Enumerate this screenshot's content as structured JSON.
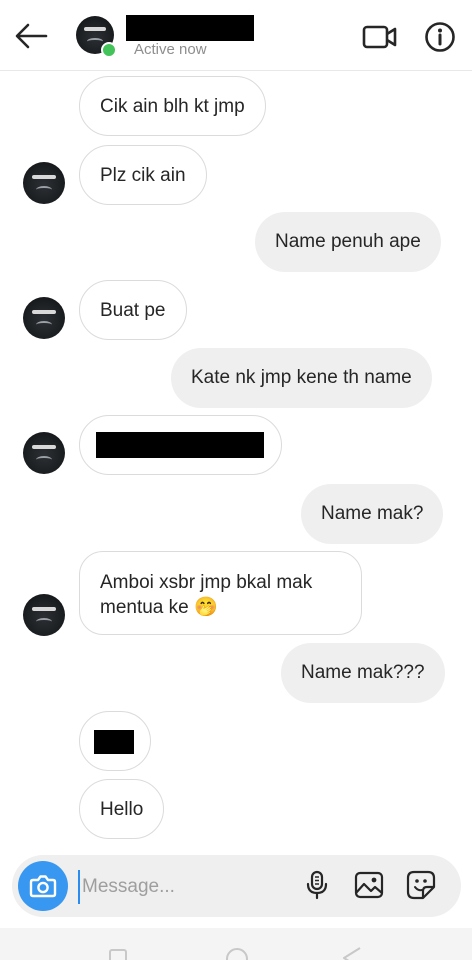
{
  "header": {
    "status": "Active now",
    "back_icon": "arrow-left-icon",
    "video_icon": "video-call-icon",
    "info_icon": "info-icon"
  },
  "messages": [
    {
      "side": "in",
      "text": "Cik ain blh kt jmp"
    },
    {
      "side": "in",
      "text": "Plz cik ain"
    },
    {
      "side": "out",
      "text": "Name penuh ape"
    },
    {
      "side": "in",
      "text": "Buat pe"
    },
    {
      "side": "out",
      "text": "Kate nk jmp kene th name"
    },
    {
      "side": "in",
      "text": "[redacted]"
    },
    {
      "side": "out",
      "text": "Name mak?"
    },
    {
      "side": "in",
      "line1": "Amboi xsbr jmp bkal mak",
      "line2": "mentua ke",
      "emoji": "🤭"
    },
    {
      "side": "out",
      "text": "Name mak???"
    },
    {
      "side": "in",
      "text": "[redacted]"
    },
    {
      "side": "in",
      "text": "Hello"
    }
  ],
  "composer": {
    "placeholder": "Message...",
    "camera_icon": "camera-icon",
    "mic_icon": "microphone-icon",
    "gallery_icon": "image-gallery-icon",
    "sticker_icon": "sticker-icon"
  },
  "colors": {
    "accent": "#3897f0",
    "online": "#44c35a",
    "outgoing_bubble": "#efefef",
    "incoming_border": "#dbdbdb"
  }
}
